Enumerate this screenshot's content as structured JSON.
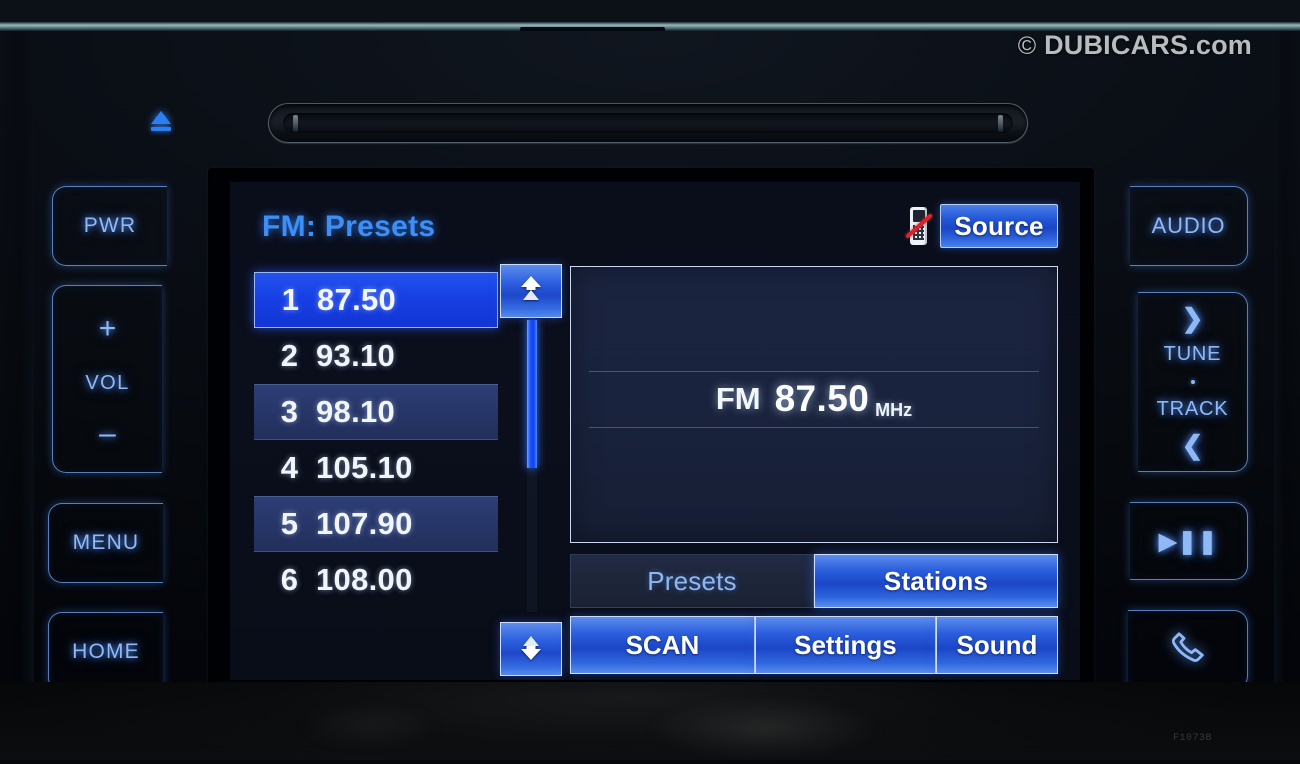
{
  "watermark": {
    "mark": "©",
    "text": "DUBICARS.com"
  },
  "model_code": "F1073B",
  "hardware": {
    "eject_icon": "eject-icon",
    "cd_slot": "cd-slot",
    "left_keys": [
      {
        "name": "power",
        "label": "PWR"
      },
      {
        "name": "volume",
        "plus": "+",
        "label": "VOL",
        "minus": "–"
      },
      {
        "name": "menu",
        "label": "MENU"
      },
      {
        "name": "home",
        "label": "HOME"
      }
    ],
    "right_keys": [
      {
        "name": "audio",
        "label": "AUDIO"
      },
      {
        "name": "tune-track",
        "up": "❯",
        "line1": "TUNE",
        "line2": "TRACK",
        "down": "❮"
      },
      {
        "name": "play-pause",
        "glyph": "▶❚❚"
      },
      {
        "name": "phone",
        "glyph": "phone-icon"
      }
    ]
  },
  "screen": {
    "title": "FM: Presets",
    "phone_status_icon": "phone-disconnected-icon",
    "source_label": "Source",
    "presets": [
      {
        "number": "1",
        "freq": "87.50",
        "selected": true,
        "alt": false
      },
      {
        "number": "2",
        "freq": "93.10",
        "selected": false,
        "alt": false
      },
      {
        "number": "3",
        "freq": "98.10",
        "selected": false,
        "alt": true
      },
      {
        "number": "4",
        "freq": "105.10",
        "selected": false,
        "alt": false
      },
      {
        "number": "5",
        "freq": "107.90",
        "selected": false,
        "alt": true
      },
      {
        "number": "6",
        "freq": "108.00",
        "selected": false,
        "alt": false
      }
    ],
    "scroll": {
      "up_icon": "chevron-up-double-icon",
      "down_icon": "chevron-down-double-icon"
    },
    "now_playing": {
      "band": "FM",
      "frequency": "87.50",
      "unit": "MHz"
    },
    "tabs": [
      {
        "label": "Presets",
        "active": false
      },
      {
        "label": "Stations",
        "active": true
      }
    ],
    "actions": [
      {
        "label": "SCAN"
      },
      {
        "label": "Settings"
      },
      {
        "label": "Sound"
      }
    ],
    "colors": {
      "accent_blue": "#2358d8",
      "title_blue": "#3e8ef7",
      "selected_blue": "#1740e4",
      "alt_row": "#273667",
      "panel_navy": "#1a233d",
      "key_glow": "#8fb9f5"
    }
  }
}
